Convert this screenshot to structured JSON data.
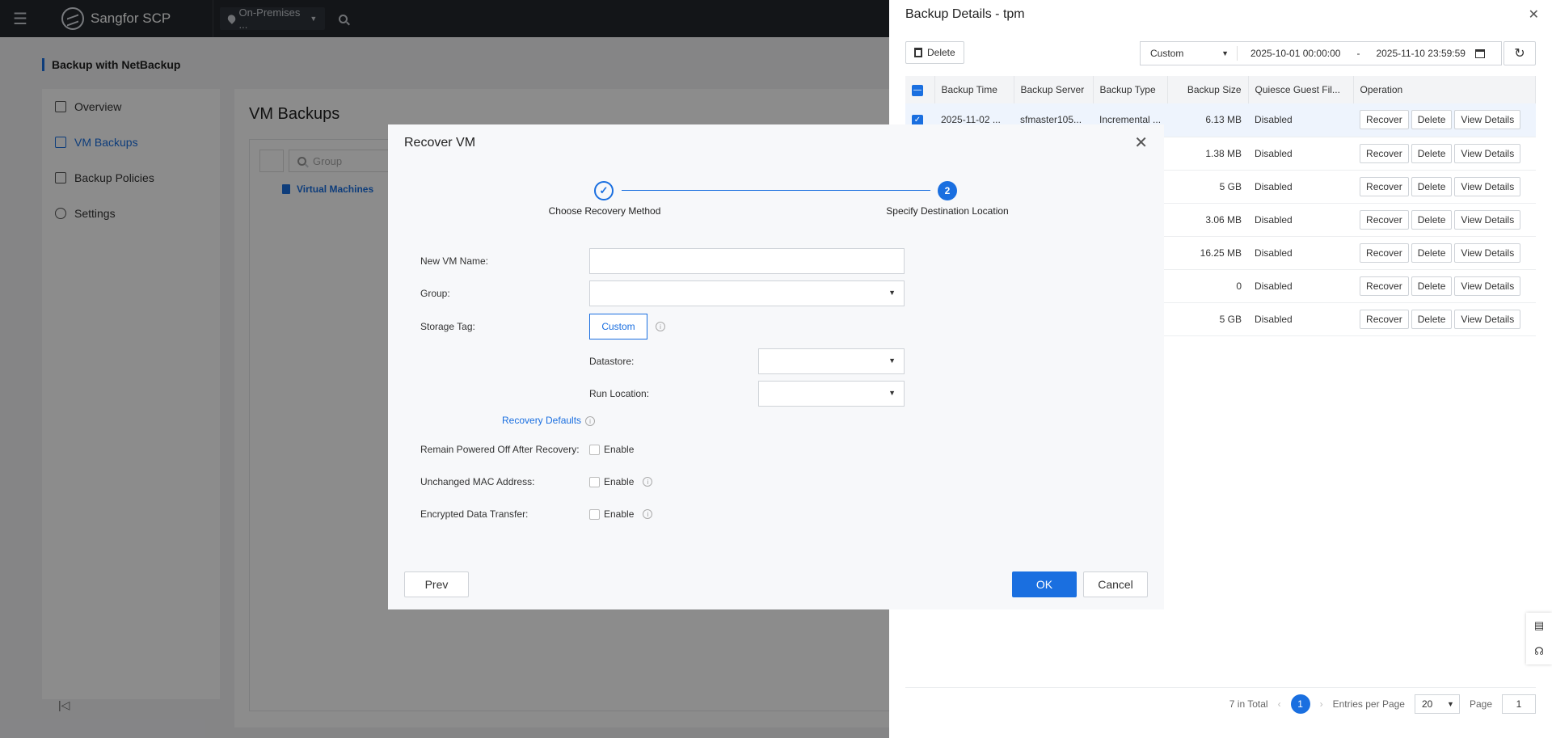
{
  "topbar": {
    "brand": "Sangfor SCP",
    "region": "On-Premises ..."
  },
  "page": {
    "breadcrumb": "Backup with NetBackup",
    "nav": [
      {
        "label": "Overview"
      },
      {
        "label": "VM Backups"
      },
      {
        "label": "Backup Policies"
      },
      {
        "label": "Settings"
      }
    ],
    "title": "VM Backups",
    "group_placeholder": "Group",
    "tree_node": "Virtual Machines"
  },
  "drawer": {
    "title": "Backup Details - tpm",
    "delete_label": "Delete",
    "range_preset": "Custom",
    "range_start": "2025-10-01 00:00:00",
    "range_sep": "-",
    "range_end": "2025-11-10 23:59:59",
    "columns": [
      "Backup Time",
      "Backup Server",
      "Backup Type",
      "Backup Size",
      "Quiesce Guest Fil...",
      "Operation"
    ],
    "rows": [
      {
        "time": "2025-11-02 ...",
        "server": "sfmaster105...",
        "type": "Incremental ...",
        "size": "6.13 MB",
        "quiesce": "Disabled",
        "selected": true
      },
      {
        "time": "",
        "server": "",
        "type": "",
        "size": "1.38 MB",
        "quiesce": "Disabled",
        "selected": false
      },
      {
        "time": "",
        "server": "",
        "type": "",
        "size": "5 GB",
        "quiesce": "Disabled",
        "selected": false
      },
      {
        "time": "",
        "server": "",
        "type": "",
        "size": "3.06 MB",
        "quiesce": "Disabled",
        "selected": false
      },
      {
        "time": "",
        "server": "",
        "type": "",
        "size": "16.25 MB",
        "quiesce": "Disabled",
        "selected": false
      },
      {
        "time": "",
        "server": "",
        "type": "",
        "size": "0",
        "quiesce": "Disabled",
        "selected": false
      },
      {
        "time": "",
        "server": "",
        "type": "",
        "size": "5 GB",
        "quiesce": "Disabled",
        "selected": false
      }
    ],
    "op_labels": {
      "recover": "Recover",
      "delete": "Delete",
      "view": "View Details"
    },
    "pager": {
      "total": "7 in Total",
      "current_page": "1",
      "entries_label": "Entries per Page",
      "entries_value": "20",
      "page_label": "Page",
      "page_value": "1"
    }
  },
  "dialog": {
    "title": "Recover VM",
    "steps": [
      {
        "label": "Choose Recovery Method",
        "state": "done"
      },
      {
        "label": "Specify Destination Location",
        "state": "current",
        "number": "2"
      }
    ],
    "fields": {
      "new_vm_name": {
        "label": "New VM Name:",
        "value": ""
      },
      "group": {
        "label": "Group:",
        "value": ""
      },
      "storage_tag": {
        "label": "Storage Tag:",
        "button": "Custom"
      },
      "datastore": {
        "label": "Datastore:",
        "value": ""
      },
      "run_location": {
        "label": "Run Location:",
        "value": ""
      }
    },
    "recovery_defaults": "Recovery Defaults",
    "options": [
      {
        "label": "Remain Powered Off After Recovery:",
        "check_label": "Enable",
        "checked": false
      },
      {
        "label": "Unchanged MAC Address:",
        "check_label": "Enable",
        "checked": false
      },
      {
        "label": "Encrypted Data Transfer:",
        "check_label": "Enable",
        "checked": false
      }
    ],
    "buttons": {
      "prev": "Prev",
      "ok": "OK",
      "cancel": "Cancel"
    }
  },
  "colors": {
    "accent": "#1a6fe0",
    "topbar": "#23272d"
  }
}
